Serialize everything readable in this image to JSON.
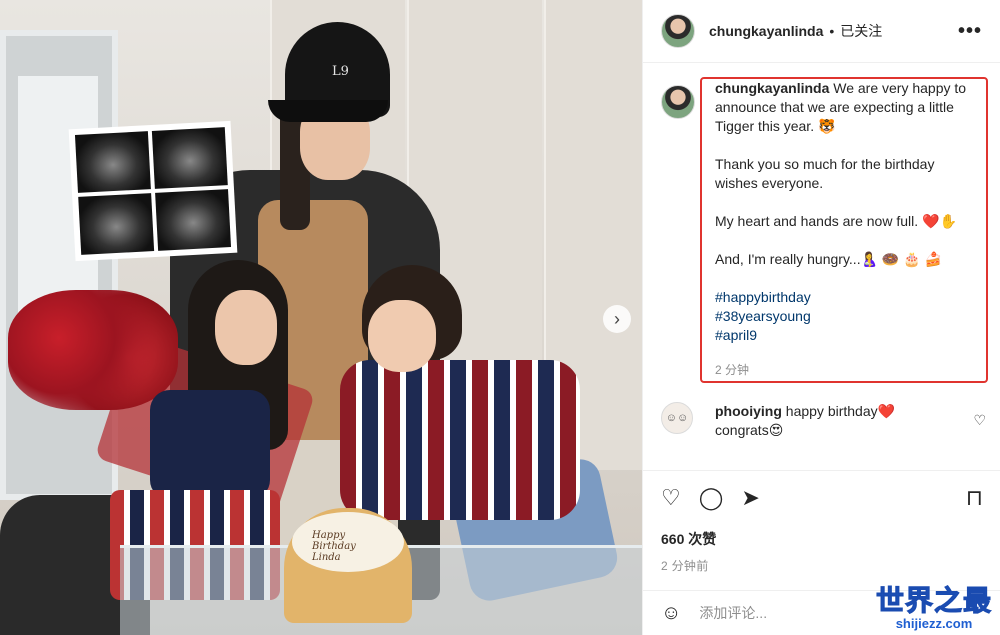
{
  "post": {
    "photo": {
      "cap_logo": "L9",
      "cake_lines": [
        "Happy",
        "Birthday",
        "Linda"
      ],
      "next_icon": "chevron-right-icon"
    },
    "header": {
      "username": "chungkayanlinda",
      "separator": "•",
      "follow_status": "已关注",
      "more_icon": "•••"
    },
    "caption": {
      "username": "chungkayanlinda",
      "para1": "We are very happy to announce that we are expecting a little Tigger this year. 🐯",
      "para2": "Thank you so much for the birthday wishes everyone.",
      "para3": "My heart and hands are now full. ❤️✋",
      "para4": "And, I'm really hungry...🤱 🍩 🎂 🍰",
      "hashtags": [
        "#happybirthday",
        "#38yearsyoung",
        "#april9"
      ],
      "time": "2 分钟"
    },
    "comment": {
      "username": "phooiying",
      "text": "happy birthday❤️",
      "text2": "congrats😍"
    },
    "actions": {
      "like_icon": "♡",
      "comment_icon": "◯",
      "share_icon": "➤",
      "bookmark_icon": "⊓",
      "likes": "660 次赞",
      "posted": "2 分钟前"
    },
    "add_comment": {
      "emoji_icon": "☺",
      "placeholder": "添加评论..."
    },
    "watermark": {
      "title": "世界之最",
      "url": "shijiezz.com"
    }
  },
  "colors": {
    "highlight_border": "#e0342f",
    "hashtag": "#00376b",
    "watermark": "#1f5fd1"
  }
}
